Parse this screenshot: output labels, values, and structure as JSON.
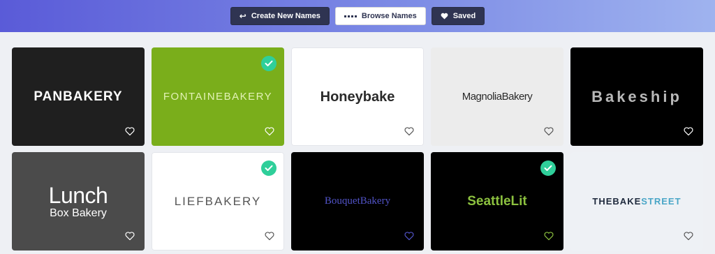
{
  "nav": {
    "create_label": "Create New Names",
    "browse_label": "Browse Names",
    "saved_label": "Saved"
  },
  "cards": [
    {
      "name": "PANBAKERY",
      "bg": "#1f1f1f",
      "selected": false,
      "heart": "#ffffff"
    },
    {
      "name": "FONTAINEBAKERY",
      "bg": "#7aae1b",
      "selected": true,
      "heart": "#ffffff"
    },
    {
      "name": "Honeybake",
      "bg": "#ffffff",
      "selected": false,
      "heart": "#555555"
    },
    {
      "name": "MagnoliaBakery",
      "bg": "#ececec",
      "selected": false,
      "heart": "#555555"
    },
    {
      "name": "Bakeship",
      "bg": "#000000",
      "selected": false,
      "heart": "#ffffff"
    },
    {
      "name_line1": "Lunch",
      "name_line2": "Box Bakery",
      "bg": "#4b4b4b",
      "selected": false,
      "heart": "#ffffff"
    },
    {
      "name": "LIEFBAKERY",
      "bg": "#ffffff",
      "selected": true,
      "heart": "#555555"
    },
    {
      "name": "BouquetBakery",
      "bg": "#000000",
      "selected": false,
      "heart": "#5153c7"
    },
    {
      "name": "SeattleLit",
      "bg": "#000000",
      "selected": true,
      "heart": "#8cc13f"
    },
    {
      "name_part1": "THEBAKE",
      "name_part2": "STREET",
      "bg": "#eef1f5",
      "selected": false,
      "heart": "#555555"
    }
  ],
  "icons": {
    "back": "arrow-left-icon",
    "grid": "grid-icon",
    "saved": "heart-icon",
    "card_heart": "heart-outline-icon",
    "check": "check-icon"
  },
  "colors": {
    "check_green": "#2fcf9a",
    "nav_dark": "#2f3452"
  }
}
